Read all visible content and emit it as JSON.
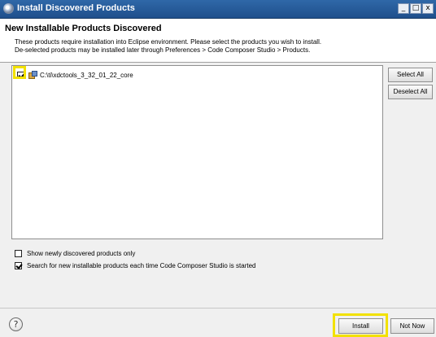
{
  "window": {
    "title": "Install Discovered Products",
    "minimize_glyph": "_",
    "maximize_glyph": "□",
    "close_glyph": "x"
  },
  "header": {
    "title": "New Installable Products Discovered",
    "description_line1": "These products require installation into Eclipse environment. Please select the products you wish to install.",
    "description_line2": "De-selected products may be installed later through Preferences > Code Composer Studio > Products."
  },
  "products": [
    {
      "label": "C:\\ti\\xdctools_3_32_01_22_core",
      "checked": true,
      "icon": "package-icon"
    }
  ],
  "side_buttons": {
    "select_all": "Select All",
    "deselect_all": "Deselect All"
  },
  "options": [
    {
      "label": "Show newly discovered products only",
      "checked": false
    },
    {
      "label": "Search for new installable products each time Code Composer Studio is started",
      "checked": true
    }
  ],
  "footer": {
    "help_glyph": "?",
    "install": "Install",
    "not_now": "Not Now"
  },
  "colors": {
    "highlight": "#f2e100",
    "titlebar": "#2f68a8"
  }
}
